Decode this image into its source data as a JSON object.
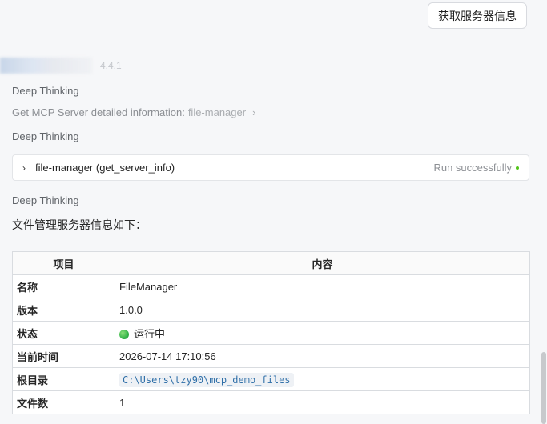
{
  "query_button": "获取服务器信息",
  "model_version": "4.4.1",
  "thinking_label": "Deep Thinking",
  "mcp_detail": {
    "text": "Get MCP Server detailed information:",
    "server": "file-manager"
  },
  "tool_call": {
    "name": "file-manager (get_server_info)",
    "status": "Run successfully"
  },
  "answer_lead": "文件管理服务器信息如下：",
  "table": {
    "headers": [
      "项目",
      "内容"
    ],
    "rows": [
      {
        "key": "名称",
        "value": "FileManager"
      },
      {
        "key": "版本",
        "value": "1.0.0"
      },
      {
        "key": "状态",
        "value": "运行中"
      },
      {
        "key": "当前时间",
        "value": "2026-07-14 17:10:56"
      },
      {
        "key": "根目录",
        "value": "C:\\Users\\tzy90\\mcp_demo_files"
      },
      {
        "key": "文件数",
        "value": "1"
      }
    ]
  },
  "colors": {
    "status_green": "#52c41a",
    "path_blue": "#2f6fa8"
  }
}
